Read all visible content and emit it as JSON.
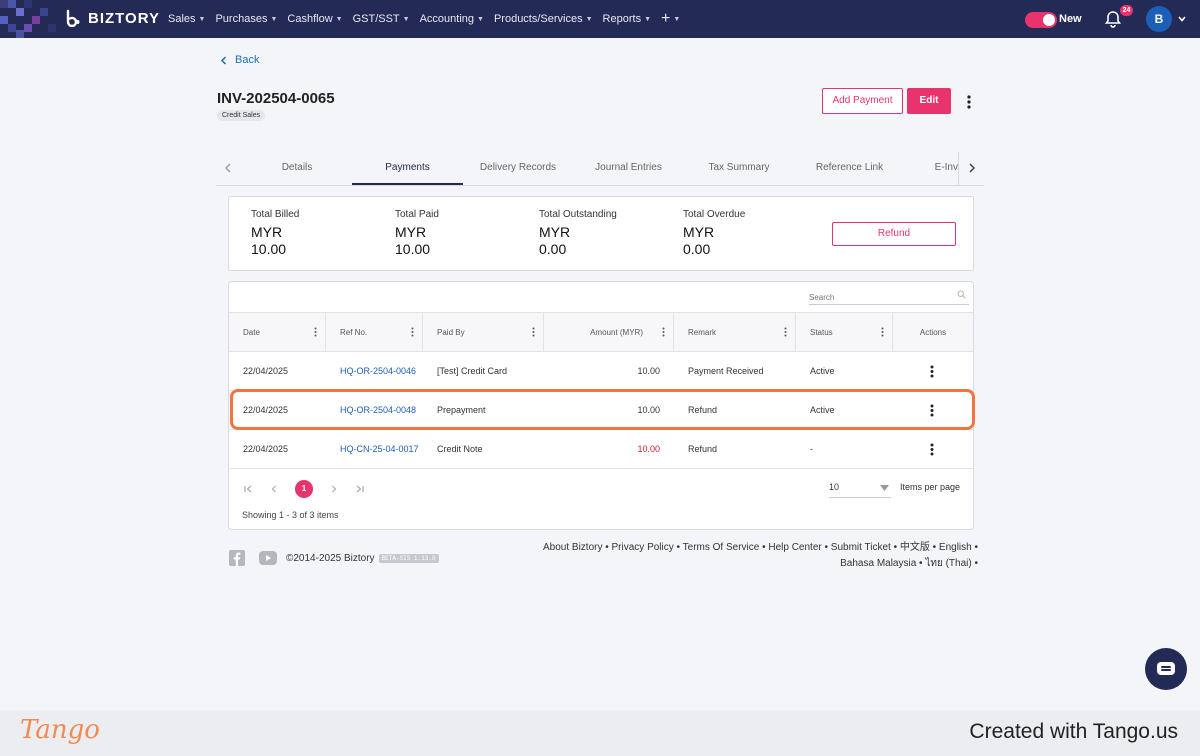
{
  "nav": {
    "brand": "BIZTORY",
    "menu": [
      "Sales",
      "Purchases",
      "Cashflow",
      "GST/SST",
      "Accounting",
      "Products/Services",
      "Reports"
    ],
    "new_label": "New",
    "notifications_count": "24",
    "avatar_initial": "B"
  },
  "page": {
    "back_label": "Back",
    "invoice_number": "INV-202504-0065",
    "invoice_type": "Credit Sales",
    "add_payment_label": "Add Payment",
    "edit_label": "Edit"
  },
  "tabs": [
    {
      "label": "Details",
      "active": false
    },
    {
      "label": "Payments",
      "active": true
    },
    {
      "label": "Delivery Records",
      "active": false
    },
    {
      "label": "Journal Entries",
      "active": false
    },
    {
      "label": "Tax Summary",
      "active": false
    },
    {
      "label": "Reference Link",
      "active": false
    },
    {
      "label": "E-Inv",
      "active": false
    }
  ],
  "summary": {
    "items": [
      {
        "label": "Total Billed",
        "currency": "MYR",
        "amount": "10.00"
      },
      {
        "label": "Total Paid",
        "currency": "MYR",
        "amount": "10.00"
      },
      {
        "label": "Total Outstanding",
        "currency": "MYR",
        "amount": "0.00"
      },
      {
        "label": "Total Overdue",
        "currency": "MYR",
        "amount": "0.00"
      }
    ],
    "refund_label": "Refund"
  },
  "table": {
    "search_placeholder": "Search",
    "columns": [
      "Date",
      "Ref No.",
      "Paid By",
      "Amount (MYR)",
      "Remark",
      "Status",
      "Actions"
    ],
    "rows": [
      {
        "date": "22/04/2025",
        "ref": "HQ-OR-2504-0046",
        "paid_by": "[Test] Credit Card",
        "amount": "10.00",
        "remark": "Payment Received",
        "status": "Active",
        "negative": false
      },
      {
        "date": "22/04/2025",
        "ref": "HQ-OR-2504-0048",
        "paid_by": "Prepayment",
        "amount": "10.00",
        "remark": "Refund",
        "status": "Active",
        "negative": false
      },
      {
        "date": "22/04/2025",
        "ref": "HQ-CN-25-04-0017",
        "paid_by": "Credit Note",
        "amount": "10.00",
        "remark": "Refund",
        "status": "-",
        "negative": true
      }
    ],
    "current_page": "1",
    "per_page": "10",
    "per_page_label": "Items per page",
    "showing": "Showing 1 - 3 of 3 items"
  },
  "footer": {
    "copyright": "©2014-2025 Biztory",
    "version": "BETA-SIS 1.13.0",
    "links_line1": "About Biztory • Privacy Policy • Terms Of Service • Help Center • Submit Ticket • 中文版 • English •",
    "links_line2": "Bahasa Malaysia • ไทย (Thai) •"
  },
  "tango": {
    "logo": "Tango",
    "credit": "Created with Tango.us"
  },
  "colors": {
    "nav_bg": "#232a55",
    "accent": "#e8336e",
    "link": "#1d5fb8",
    "highlight": "#f07540",
    "negative_amount": "#d11a2a"
  }
}
